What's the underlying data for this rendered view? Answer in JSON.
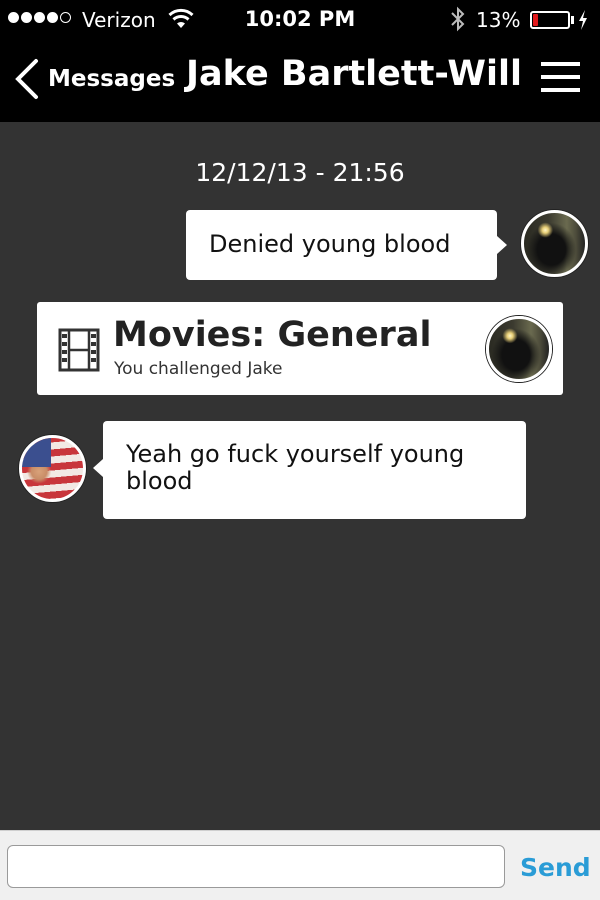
{
  "status_bar": {
    "carrier": "Verizon",
    "time": "10:02 PM",
    "battery_percent": "13%",
    "battery_level": 0.13,
    "signal_bars": 4,
    "signal_max": 5,
    "icons": [
      "wifi-icon",
      "bluetooth-icon",
      "battery-icon",
      "charging-bolt-icon"
    ]
  },
  "nav": {
    "back_label": "Messages",
    "title": "Jake Bartlett-Will",
    "menu_icon": "hamburger-menu-icon"
  },
  "chat": {
    "timestamp": "12/12/13 - 21:56",
    "messages": [
      {
        "direction": "outgoing",
        "text": "Denied young blood"
      },
      {
        "type": "challenge",
        "title": "Movies: General",
        "subtitle": "You challenged Jake",
        "icon": "film-icon"
      },
      {
        "direction": "incoming",
        "text": "Yeah go fuck yourself young blood"
      }
    ]
  },
  "composer": {
    "input_value": "",
    "placeholder": "",
    "send_label": "Send"
  },
  "colors": {
    "background": "#333333",
    "bar": "#000000",
    "send": "#2a9cd6",
    "battery_low": "#e0191c"
  }
}
